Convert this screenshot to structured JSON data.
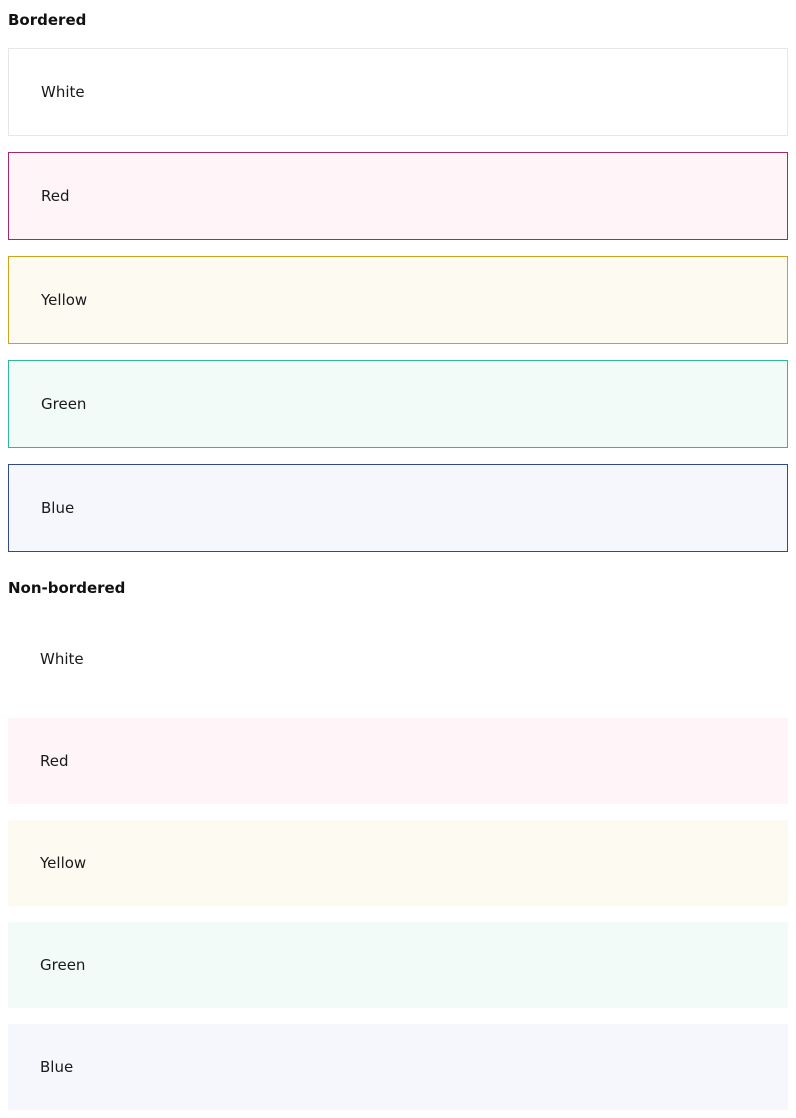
{
  "sections": [
    {
      "title": "Bordered",
      "panels": [
        {
          "label": "White",
          "background": "#ffffff",
          "border": "#e6e6e6"
        },
        {
          "label": "Red",
          "background": "#fff4f8",
          "border": "#a3296b"
        },
        {
          "label": "Yellow",
          "background": "#fdfaf2",
          "border": "#d0a21c"
        },
        {
          "label": "Green",
          "background": "#f2fbf8",
          "border": "#2fb89a"
        },
        {
          "label": "Blue",
          "background": "#f6f7fc",
          "border": "#2d4b8e"
        }
      ]
    },
    {
      "title": "Non-bordered",
      "panels": [
        {
          "label": "White",
          "background": "#ffffff"
        },
        {
          "label": "Red",
          "background": "#fff4f8"
        },
        {
          "label": "Yellow",
          "background": "#fdfaf2"
        },
        {
          "label": "Green",
          "background": "#f2fbf8"
        },
        {
          "label": "Blue",
          "background": "#f6f7fc"
        }
      ]
    }
  ]
}
